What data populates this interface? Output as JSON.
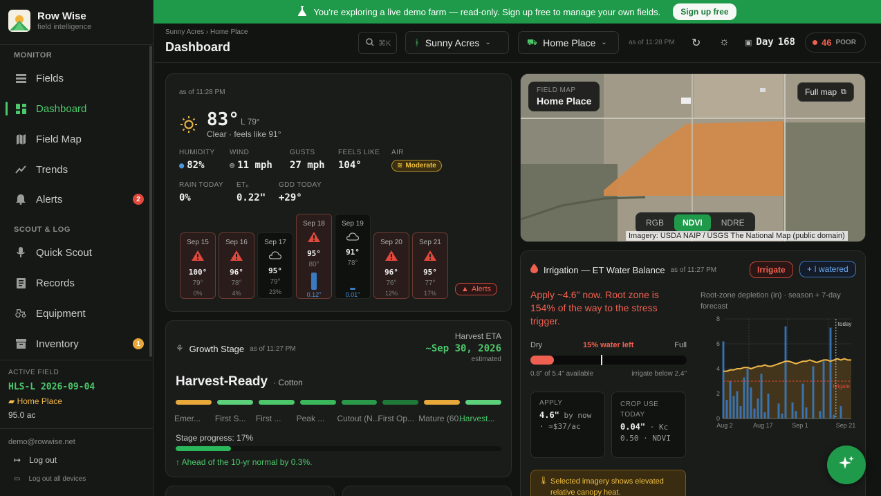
{
  "brand": {
    "name": "Row Wise",
    "subtitle": "field intelligence"
  },
  "sidebar": {
    "sections": {
      "monitor": "MONITOR",
      "scout": "SCOUT & LOG"
    },
    "items": [
      {
        "label": "Fields",
        "icon": "list-icon"
      },
      {
        "label": "Dashboard",
        "icon": "grid-icon"
      },
      {
        "label": "Field Map",
        "icon": "map-icon"
      },
      {
        "label": "Trends",
        "icon": "trend-icon"
      },
      {
        "label": "Alerts",
        "icon": "bell-icon",
        "badge": "2"
      },
      {
        "label": "Quick Scout",
        "icon": "mic-icon"
      },
      {
        "label": "Records",
        "icon": "records-icon"
      },
      {
        "label": "Equipment",
        "icon": "tractor-icon"
      },
      {
        "label": "Inventory",
        "icon": "archive-icon",
        "badge": "1"
      }
    ],
    "active_field": {
      "label": "ACTIVE FIELD",
      "code": "HLS-L 2026-09-04",
      "place": "Home Place",
      "acres": "95.0 ac"
    },
    "email": "demo@rowwise.net",
    "logout": "Log out",
    "logout_all": "Log out all devices"
  },
  "banner": {
    "text": "You're exploring a live demo farm — read-only. Sign up free to manage your own fields.",
    "button": "Sign up free"
  },
  "header": {
    "breadcrumb": "Sunny Acres › Home Place",
    "title": "Dashboard",
    "search_shortcut": "⌘K",
    "farm": "Sunny Acres",
    "field": "Home Place",
    "asof": "as of 11:28 PM",
    "day_label": "Day",
    "day_value": "168",
    "aqi_value": "46",
    "aqi_label": "POOR"
  },
  "weather": {
    "asof": "as of 11:28 PM",
    "temp": "83°",
    "low": "L 79°",
    "desc": "Clear · feels like 91°",
    "metrics": [
      {
        "label": "HUMIDITY",
        "value": "82%"
      },
      {
        "label": "WIND",
        "value": "11 mph"
      },
      {
        "label": "GUSTS",
        "value": "27 mph"
      },
      {
        "label": "FEELS LIKE",
        "value": "104°"
      },
      {
        "label": "AIR",
        "value": "Moderate"
      },
      {
        "label": "RAIN TODAY",
        "value": "0%"
      },
      {
        "label": "ETₒ",
        "value": "0.22\""
      },
      {
        "label": "GDD TODAY",
        "value": "+29°"
      }
    ],
    "forecast": [
      {
        "date": "Sep 15",
        "hi": "100°",
        "lo": "79°",
        "precip": "0%",
        "kind": "hot",
        "rain": 0
      },
      {
        "date": "Sep 16",
        "hi": "96°",
        "lo": "78°",
        "precip": "4%",
        "kind": "hot",
        "rain": 0
      },
      {
        "date": "Sep 17",
        "hi": "95°",
        "lo": "79°",
        "precip": "23%",
        "kind": "cool",
        "rain": 0
      },
      {
        "date": "Sep 18",
        "hi": "95°",
        "lo": "80°",
        "precip": "0.12\"",
        "kind": "hot",
        "rain": 0.12
      },
      {
        "date": "Sep 19",
        "hi": "91°",
        "lo": "78°",
        "precip": "0.01\"",
        "kind": "cool",
        "rain": 0.01
      },
      {
        "date": "Sep 20",
        "hi": "96°",
        "lo": "76°",
        "precip": "12%",
        "kind": "hot",
        "rain": 0
      },
      {
        "date": "Sep 21",
        "hi": "95°",
        "lo": "77°",
        "precip": "17%",
        "kind": "hot",
        "rain": 0
      }
    ],
    "alerts_label": "Alerts"
  },
  "growth": {
    "title": "Growth Stage",
    "asof": "as of 11:27 PM",
    "eta_label": "Harvest ETA",
    "eta_value": "~Sep 30, 2026",
    "eta_note": "estimated",
    "stage": "Harvest-Ready",
    "crop": "· Cotton",
    "stages": [
      "Emer...",
      "First S...",
      "First ...",
      "Peak ...",
      "Cutout (N...",
      "First Op...",
      "Mature (60...",
      "Harvest..."
    ],
    "stage_colors": [
      "#e8a83a",
      "#5cd07a",
      "#4cc76a",
      "#3cb85c",
      "#2a9a4a",
      "#1f7a3a",
      "#e8a83a",
      "#5cd07a"
    ],
    "progress_label": "Stage progress: 17%",
    "progress": 0.17,
    "ahead": "↑ Ahead of the 10-yr normal by 0.3%."
  },
  "map": {
    "tag_label": "FIELD MAP",
    "tag_value": "Home Place",
    "full_map": "Full map",
    "modes": [
      "RGB",
      "NDVI",
      "NDRE"
    ],
    "active_mode": "NDVI",
    "credit": "Imagery: USDA NAIP / USGS The National Map (public domain)"
  },
  "irrigation": {
    "title": "Irrigation — ET Water Balance",
    "asof": "as of 11:27 PM",
    "status": "Irrigate",
    "watered": "+ I watered",
    "headline": "Apply ~4.6\" now. Root zone is 154% of the way to the stress trigger.",
    "dry": "Dry",
    "water_left": "15% water left",
    "full": "Full",
    "water_frac": 0.15,
    "available": "0.8\" of 5.4\" available",
    "irrigate_below": "irrigate below 2.4\"",
    "apply_label": "APPLY",
    "apply_value": "4.6\"",
    "apply_rest": "by now · ≈$37/ac",
    "crop_label": "CROP USE TODAY",
    "crop_value": "0.04\"",
    "crop_rest": "· Kc 0.50 · NDVI",
    "warning": "Selected imagery shows elevated relative canopy heat.",
    "chart_title": "Root-zone depletion (in) · season + 7-day forecast"
  },
  "chart_data": {
    "type": "bar",
    "title": "Root-zone depletion (in) · season + 7-day forecast",
    "ylim": [
      0,
      8
    ],
    "yticks": [
      "0",
      "2",
      "4",
      "6",
      "8"
    ],
    "xticks": [
      "Aug 2",
      "Aug 17",
      "Sep 1",
      "Sep 21"
    ],
    "today_label": "today",
    "irrigate_label": "Irrigate",
    "irrigate_threshold": 3.0,
    "depletion": [
      3.8,
      3.8,
      3.9,
      3.9,
      4.0,
      4.0,
      4.1,
      4.1,
      4.0,
      4.1,
      4.2,
      4.2,
      4.3,
      4.2,
      4.2,
      4.3,
      4.4,
      4.5,
      4.6,
      4.6,
      4.5,
      4.4,
      4.5,
      4.6,
      4.6,
      4.7,
      4.6,
      4.5,
      4.6,
      4.7,
      4.7,
      4.6,
      4.7,
      4.8,
      4.7,
      4.8,
      4.7,
      4.7
    ],
    "rain": [
      6.2,
      1.5,
      3.0,
      1.8,
      2.2,
      1.0,
      3.3,
      4.0,
      2.5,
      0.8,
      1.6,
      3.6,
      0.5,
      2.0,
      0.0,
      0.0,
      1.2,
      0.4,
      7.4,
      0.0,
      1.3,
      0.6,
      0.0,
      2.8,
      0.9,
      0.0,
      4.2,
      0.0,
      0.6,
      4.6,
      0.0,
      7.3,
      0.3,
      0.0,
      1.0,
      0.0,
      0.0,
      0.0
    ]
  },
  "colors": {
    "accent": "#4cc76a",
    "banner": "#1f9a4a",
    "danger": "#f06050",
    "warn": "#f0c040",
    "rain": "#3a7ac0"
  }
}
